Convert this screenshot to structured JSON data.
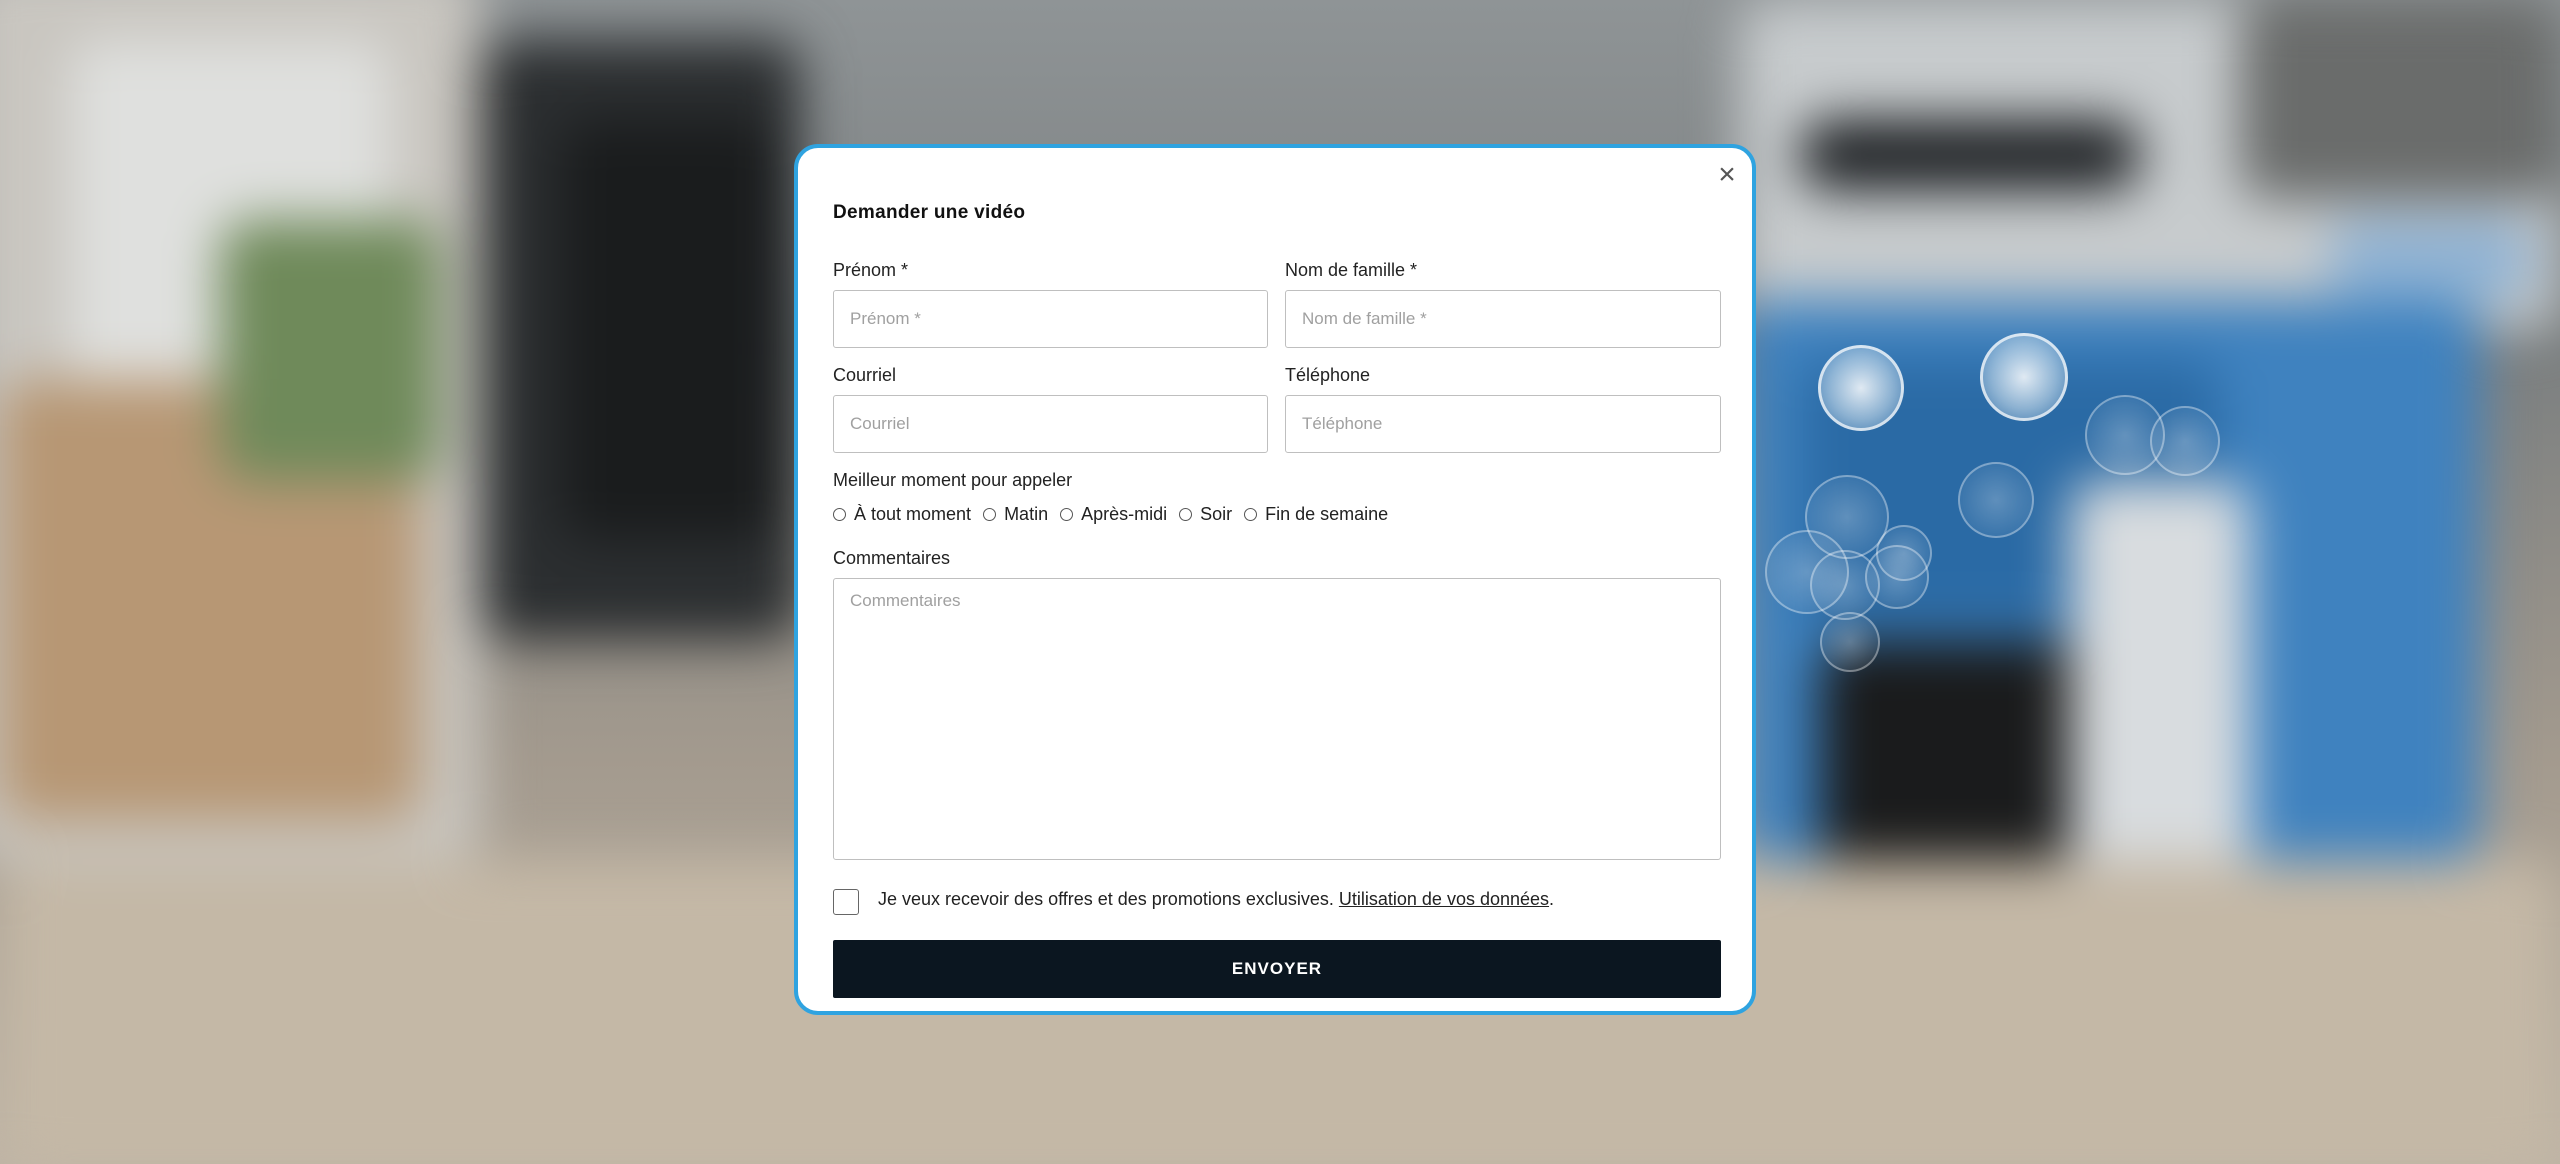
{
  "modal": {
    "title": "Demander une vidéo",
    "close_icon": "×",
    "fields": {
      "first_name": {
        "label": "Prénom *",
        "placeholder": "Prénom *",
        "value": ""
      },
      "last_name": {
        "label": "Nom de famille *",
        "placeholder": "Nom de famille *",
        "value": ""
      },
      "email": {
        "label": "Courriel",
        "placeholder": "Courriel",
        "value": ""
      },
      "phone": {
        "label": "Téléphone",
        "placeholder": "Téléphone",
        "value": ""
      }
    },
    "best_time": {
      "label": "Meilleur moment pour appeler",
      "options": [
        "À tout moment",
        "Matin",
        "Après-midi",
        "Soir",
        "Fin de semaine"
      ]
    },
    "comments": {
      "label": "Commentaires",
      "placeholder": "Commentaires",
      "value": ""
    },
    "consent": {
      "text": "Je veux recevoir des offres et des promotions exclusives. ",
      "link_text": "Utilisation de vos données",
      "suffix": ".",
      "checked": false
    },
    "submit_label": "ENVOYER"
  },
  "colors": {
    "modal_border": "#2fa3e0",
    "submit_background": "#0b1620",
    "submit_text": "#ffffff"
  },
  "icons": {
    "close": "close-icon",
    "radio": "radio-circle",
    "checkbox": "checkbox-square"
  }
}
